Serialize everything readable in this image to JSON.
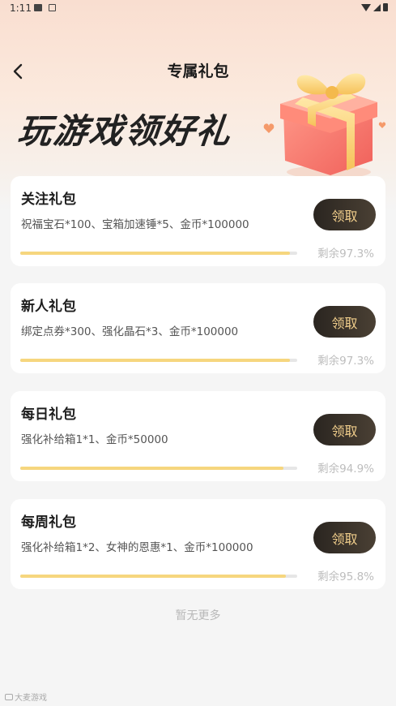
{
  "status_bar": {
    "time": "1:11"
  },
  "header": {
    "back_icon": "chevron-left-icon",
    "title": "专属礼包"
  },
  "banner": {
    "text": "玩游戏领好礼",
    "decor": "gift-box-icon"
  },
  "packages": [
    {
      "title": "关注礼包",
      "desc": "祝福宝石*100、宝箱加速锤*5、金币*100000",
      "button": "领取",
      "remaining_percent": 97.3,
      "remaining_text": "剩余97.3%"
    },
    {
      "title": "新人礼包",
      "desc": "绑定点券*300、强化晶石*3、金币*100000",
      "button": "领取",
      "remaining_percent": 97.3,
      "remaining_text": "剩余97.3%"
    },
    {
      "title": "每日礼包",
      "desc": "强化补给箱1*1、金币*50000",
      "button": "领取",
      "remaining_percent": 94.9,
      "remaining_text": "剩余94.9%"
    },
    {
      "title": "每周礼包",
      "desc": "强化补给箱1*2、女神的恩惠*1、金币*100000",
      "button": "领取",
      "remaining_percent": 95.8,
      "remaining_text": "剩余95.8%"
    }
  ],
  "footer": {
    "no_more": "暂无更多"
  },
  "watermark": {
    "text": "大麦游戏"
  },
  "colors": {
    "button_bg": "#2a2520",
    "button_text": "#f2cf8c",
    "progress_fill": "#f6d67e"
  }
}
